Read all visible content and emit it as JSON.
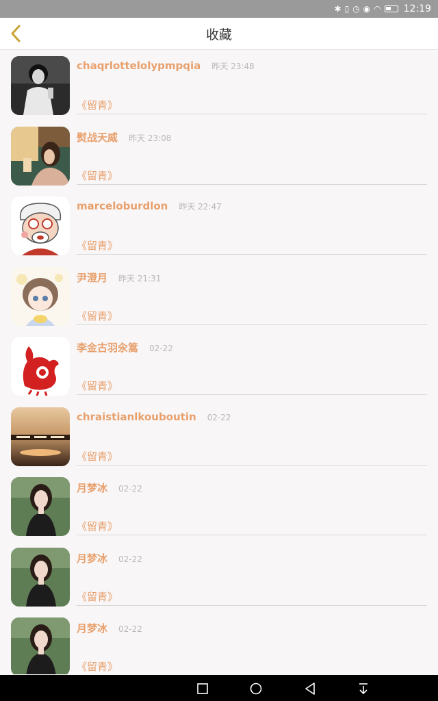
{
  "status_bar": {
    "time": "12:19",
    "icons": [
      "bluetooth-icon",
      "vibrate-icon",
      "alarm-icon",
      "eye-icon",
      "wifi-icon",
      "battery-icon"
    ]
  },
  "header": {
    "title": "收藏",
    "back_icon": "chevron-left-icon"
  },
  "colors": {
    "accent": "#e8a06c",
    "back_icon": "#c9a234",
    "time_text": "#b9b9b9",
    "background": "#f8f6f7"
  },
  "items": [
    {
      "name": "chaqrlottelolypmpqia",
      "time": "昨天 23:48",
      "comment": "《留青》",
      "avatar": "bw-photo"
    },
    {
      "name": "熨战天威",
      "time": "昨天 23:08",
      "comment": "《留青》",
      "avatar": "girl-photo"
    },
    {
      "name": "marceloburdlon",
      "time": "昨天 22:47",
      "comment": "《留青》",
      "avatar": "cartoon-grandpa"
    },
    {
      "name": "尹澄月",
      "time": "昨天 21:31",
      "comment": "《留青》",
      "avatar": "anime-girl"
    },
    {
      "name": "李金古羽汆篙",
      "time": "02-22",
      "comment": "《留青》",
      "avatar": "papercut-rooster"
    },
    {
      "name": "chraistianlkouboutin",
      "time": "02-22",
      "comment": "《留青》",
      "avatar": "sunset-sea"
    },
    {
      "name": "月梦冰",
      "time": "02-22",
      "comment": "《留青》",
      "avatar": "woman-portrait"
    },
    {
      "name": "月梦冰",
      "time": "02-22",
      "comment": "《留青》",
      "avatar": "woman-portrait"
    },
    {
      "name": "月梦冰",
      "time": "02-22",
      "comment": "《留青》",
      "avatar": "woman-portrait"
    }
  ],
  "nav_bar": {
    "buttons": [
      "recent-apps-icon",
      "home-icon",
      "back-icon",
      "notification-pull-icon"
    ]
  }
}
